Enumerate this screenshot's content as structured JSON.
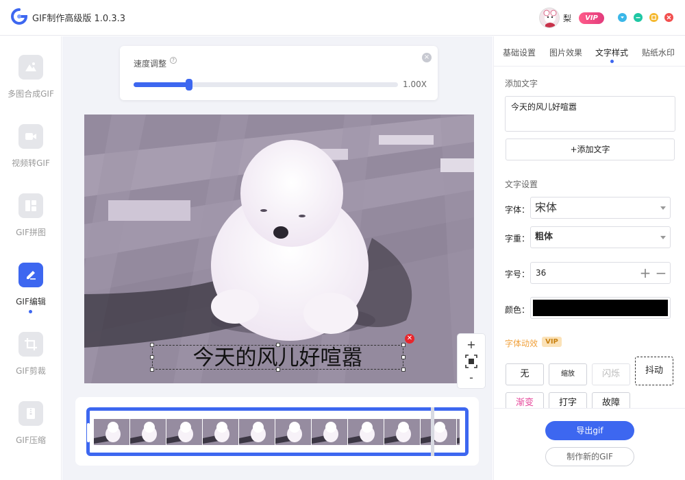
{
  "app": {
    "title": "GIF制作高级版 1.0.3.3",
    "username": "梨",
    "vip_label": "VIP"
  },
  "window_controls": [
    {
      "name": "settings-dropdown",
      "color": "#3bb7e8"
    },
    {
      "name": "minimize",
      "color": "#1fc7a4"
    },
    {
      "name": "maximize",
      "color": "#f5b82e"
    },
    {
      "name": "close",
      "color": "#f2504f"
    }
  ],
  "sidebar": {
    "items": [
      {
        "label": "多图合成GIF",
        "icon": "mountain-image-icon",
        "active": false
      },
      {
        "label": "视频转GIF",
        "icon": "video-icon",
        "active": false
      },
      {
        "label": "GIF拼图",
        "icon": "layout-grid-icon",
        "active": false
      },
      {
        "label": "GIF编辑",
        "icon": "pencil-icon",
        "active": true
      },
      {
        "label": "GIF剪裁",
        "icon": "crop-icon",
        "active": false
      },
      {
        "label": "GIF压缩",
        "icon": "zip-archive-icon",
        "active": false
      }
    ]
  },
  "speed": {
    "label": "速度调整",
    "help_icon": "help-circle-icon",
    "value_text": "1.00X",
    "slider_fraction": 0.21
  },
  "preview": {
    "caption": "今天的风儿好喧嚣"
  },
  "zoom": {
    "plus": "+",
    "minus": "-"
  },
  "tabs": [
    {
      "label": "基础设置",
      "active": false
    },
    {
      "label": "图片效果",
      "active": false
    },
    {
      "label": "文字样式",
      "active": true
    },
    {
      "label": "贴纸水印",
      "active": false
    }
  ],
  "text_panel": {
    "add_text_title": "添加文字",
    "text_value": "今天的风儿好喧嚣",
    "add_text_button": "+添加文字",
    "settings_title": "文字设置",
    "font_label": "字体：",
    "font_value": "宋体",
    "weight_label": "字重：",
    "weight_value": "粗体",
    "size_label": "字号：",
    "size_value": "36",
    "color_label": "颜色：",
    "color_value": "#000000",
    "anim_title": "字体动效",
    "anim_vip": "VIP"
  },
  "effects": [
    {
      "label": "无",
      "state": "normal"
    },
    {
      "label": "缩放",
      "state": "small"
    },
    {
      "label": "闪烁",
      "state": "disabled"
    },
    {
      "label": "抖动",
      "state": "selected"
    },
    {
      "label": "渐变",
      "state": "pink"
    },
    {
      "label": "打字",
      "state": "normal"
    },
    {
      "label": "故障",
      "state": "normal"
    }
  ],
  "footer": {
    "export_button": "导出gif",
    "new_button": "制作新的GIF"
  },
  "colors": {
    "accent": "#3d67f0",
    "anim_title": "#f0a13c"
  }
}
